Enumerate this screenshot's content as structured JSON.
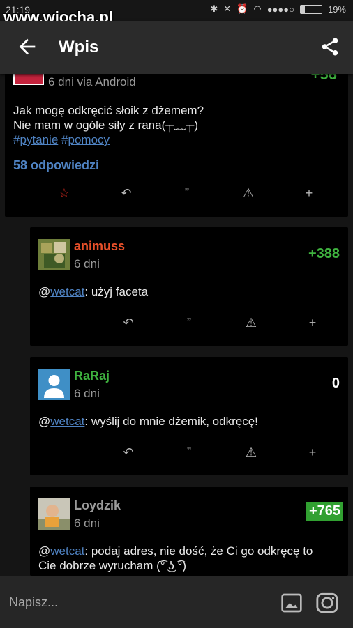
{
  "status_bar": {
    "time": "21:19",
    "watermark": "www.wiocha.pl",
    "battery": "19%",
    "signal_dots": "●●●●○"
  },
  "app_bar": {
    "title": "Wpis"
  },
  "post": {
    "meta": "6 dni via Android",
    "vote_partial": "+56",
    "line1": "Jak mogę odkręcić słoik z dżemem?",
    "line2": "Nie mam w ogóle siły z rana(┬﹏┬)",
    "hash1": "#",
    "tag1": "pytanie",
    "hash2": "#",
    "tag2": "pomocy",
    "replies": "58 odpowiedzi"
  },
  "comments": [
    {
      "author": "animuss",
      "author_color": "#e8502a",
      "time": "6 dni",
      "vote": "+388",
      "at": "@",
      "mention": "wetcat",
      "text": ": użyj faceta"
    },
    {
      "author": "RaRaj",
      "author_color": "#3fb33f",
      "time": "6 dni",
      "vote": "0",
      "at": "@",
      "mention": "wetcat",
      "text": ": wyślij do mnie dżemik, odkręcę!"
    },
    {
      "author": "Loydzik",
      "author_color": "#9a9a9a",
      "time": "6 dni",
      "vote": "+765",
      "at": "@",
      "mention": "wetcat",
      "text_line1": ": podaj adres, nie dość, że Ci go odkręcę to",
      "text_line2": "Cie dobrze wyrucham (͡° ͜ʖ ͡°)"
    }
  ],
  "composer": {
    "placeholder": "Napisz..."
  },
  "icons": {
    "favorite": "star-icon",
    "reply": "reply-icon",
    "quote": "quote-icon",
    "report": "warning-icon",
    "more": "plus-icon"
  },
  "colors": {
    "link": "#4f83c3",
    "vote_positive": "#3fb33f",
    "star": "#d2281e"
  }
}
